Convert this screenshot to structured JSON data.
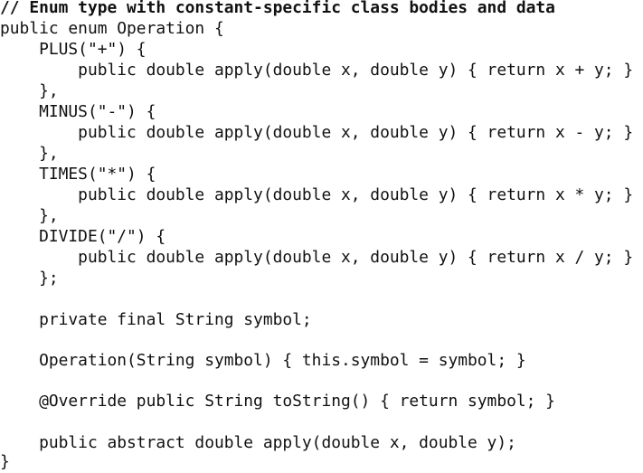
{
  "code": {
    "lines": [
      "// Enum type with constant-specific class bodies and data",
      "public enum Operation {",
      "    PLUS(\"+\") {",
      "        public double apply(double x, double y) { return x + y; }",
      "    },",
      "    MINUS(\"-\") {",
      "        public double apply(double x, double y) { return x - y; }",
      "    },",
      "    TIMES(\"*\") {",
      "        public double apply(double x, double y) { return x * y; }",
      "    },",
      "    DIVIDE(\"/\") {",
      "        public double apply(double x, double y) { return x / y; }",
      "    };",
      "",
      "    private final String symbol;",
      "",
      "    Operation(String symbol) { this.symbol = symbol; }",
      "",
      "    @Override public String toString() { return symbol; }",
      "",
      "    public abstract double apply(double x, double y);",
      "}"
    ]
  }
}
